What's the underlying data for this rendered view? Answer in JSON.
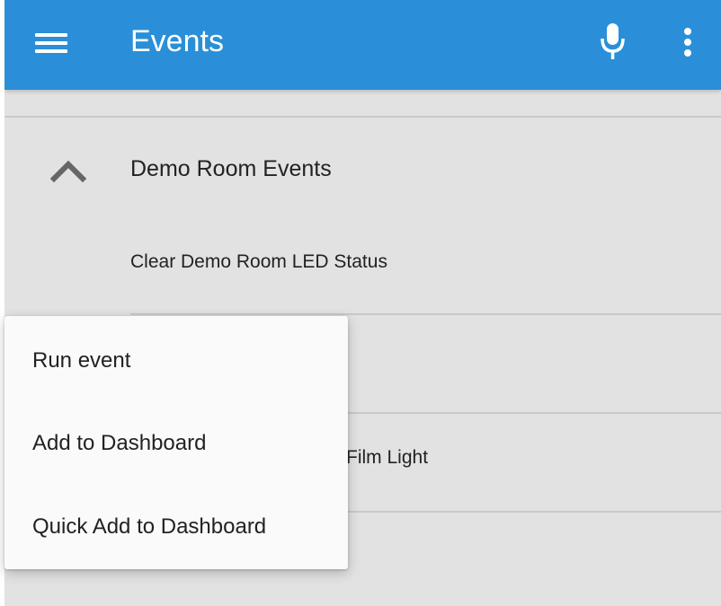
{
  "appbar": {
    "title": "Events",
    "color": "#2a8fd8",
    "icons": {
      "menu": "hamburger-menu-icon",
      "voice": "microphone-icon",
      "overflow": "more-vert-icon"
    }
  },
  "group": {
    "title": "Demo Room Events",
    "expanded": true,
    "icon": "chevron-up-icon"
  },
  "events": [
    {
      "label": "Clear Demo Room LED Status"
    },
    {
      "label": ""
    },
    {
      "label": "Film Light"
    }
  ],
  "context_menu": {
    "items": [
      {
        "label": "Run event"
      },
      {
        "label": "Add to Dashboard"
      },
      {
        "label": "Quick Add to Dashboard"
      }
    ]
  }
}
